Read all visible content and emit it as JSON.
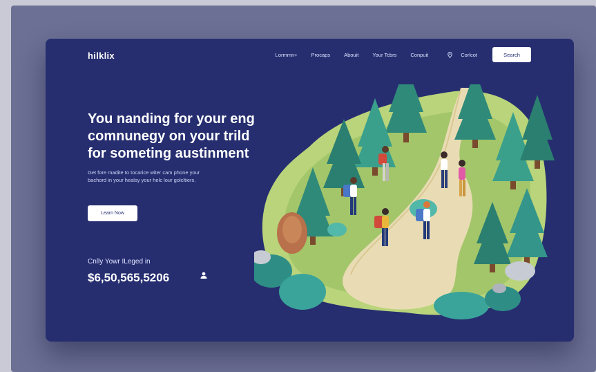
{
  "brand": "hilklix",
  "nav": {
    "items": [
      "Lormmn+",
      "Procaps",
      "Abouit",
      "Your Tcbrs",
      "Conpuit"
    ],
    "contact_label": "Corlcot",
    "search_label": "Search"
  },
  "hero": {
    "headline_lines": [
      "You nanding for your eng",
      "comnunegy on your trild",
      "for someting austinment"
    ],
    "subtext_lines": [
      "Get fore madite to tocarice witer cam phone your",
      "bachord in your healsy your helc lour golcltiers."
    ],
    "cta_label": "Learn Now"
  },
  "stats": {
    "label": "Cnlly Yowr ILeged in",
    "value": "$6,50,565,5206"
  },
  "colors": {
    "card_bg": "#262e70",
    "backdrop": "#6c7094",
    "accent_white": "#ffffff",
    "trail": "#e9dcb4",
    "forest_green": "#2f8a7a"
  }
}
